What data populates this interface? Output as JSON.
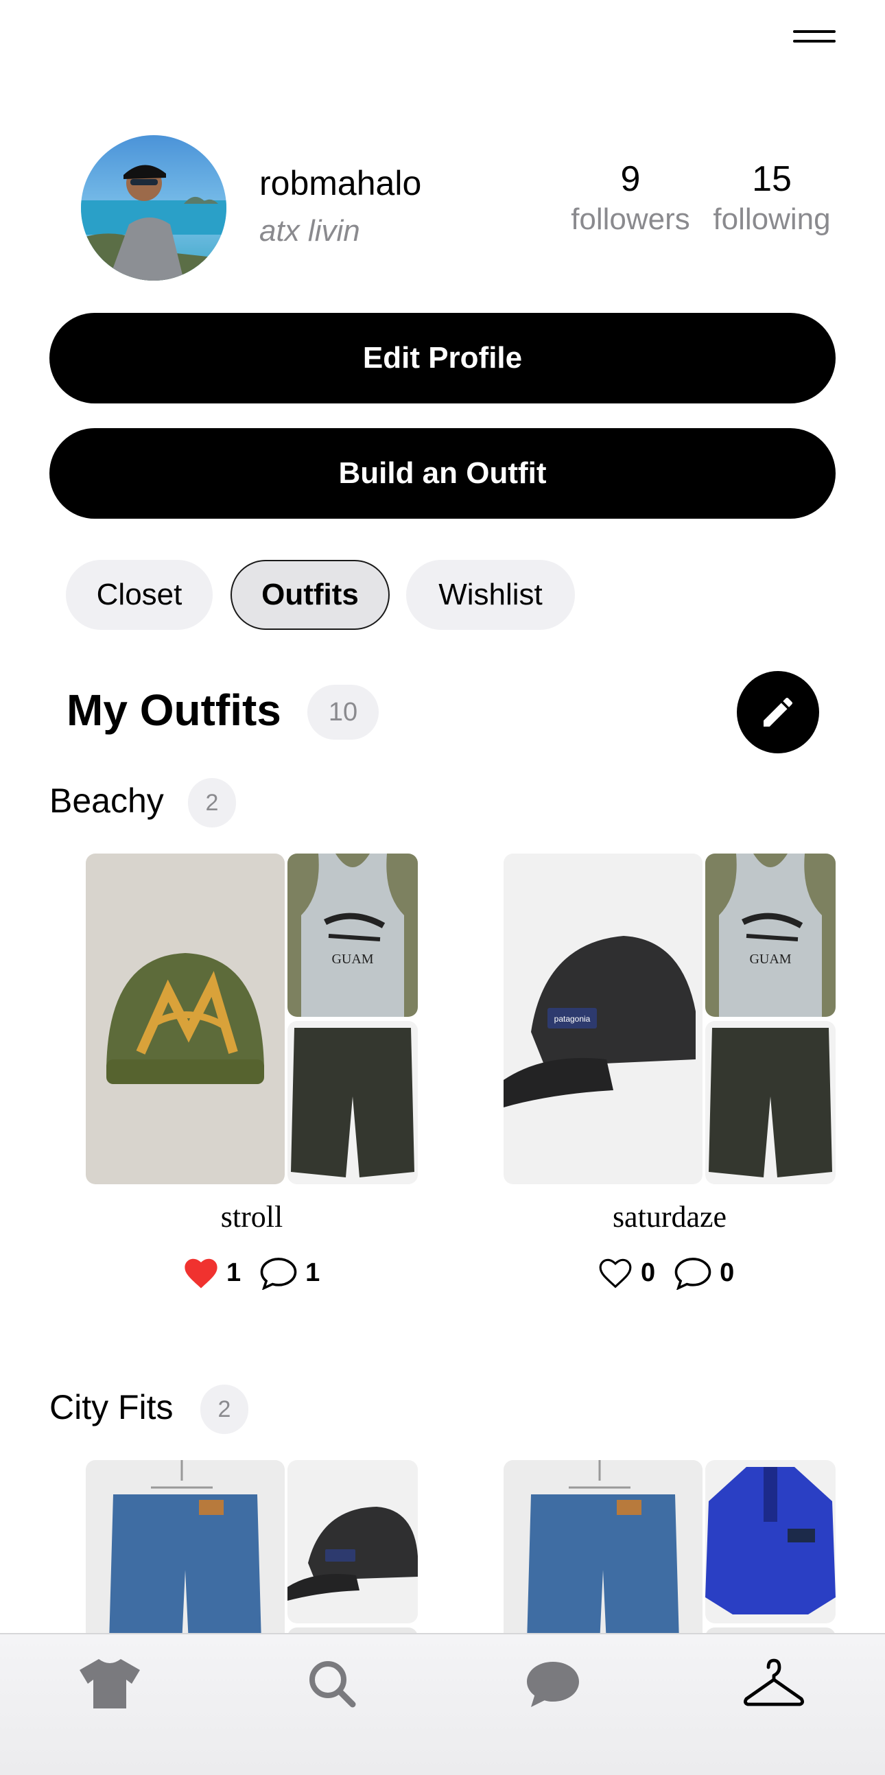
{
  "profile": {
    "username": "robmahalo",
    "bio": "atx livin",
    "followers_count": "9",
    "followers_label": "followers",
    "following_count": "15",
    "following_label": "following"
  },
  "actions": {
    "edit_profile": "Edit Profile",
    "build_outfit": "Build an Outfit"
  },
  "tabs": [
    {
      "label": "Closet",
      "active": false
    },
    {
      "label": "Outfits",
      "active": true
    },
    {
      "label": "Wishlist",
      "active": false
    }
  ],
  "section": {
    "title": "My Outfits",
    "count": "10"
  },
  "groups": [
    {
      "title": "Beachy",
      "count": "2",
      "outfits": [
        {
          "name": "stroll",
          "likes": "1",
          "comments": "1",
          "liked": true
        },
        {
          "name": "saturdaze",
          "likes": "0",
          "comments": "0",
          "liked": false
        }
      ]
    },
    {
      "title": "City Fits",
      "count": "2"
    }
  ],
  "nav": [
    "shirt-icon",
    "search-icon",
    "chat-bubble-icon",
    "hanger-icon"
  ],
  "colors": {
    "accent": "#000000",
    "like": "#f0322f",
    "muted": "#8a8a8e",
    "chip_bg": "#f0f0f3"
  }
}
